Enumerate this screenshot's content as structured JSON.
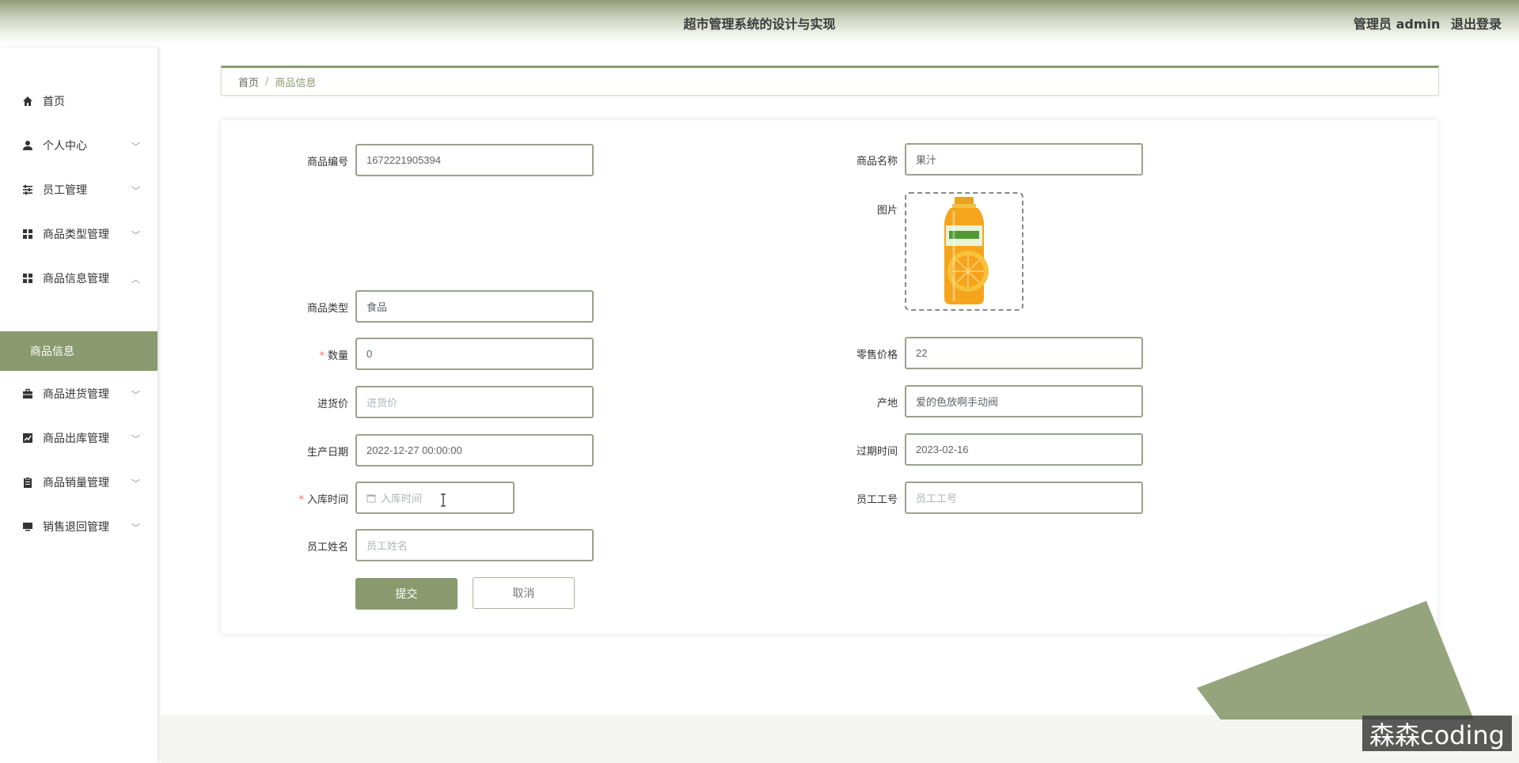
{
  "header": {
    "title": "超市管理系统的设计与实现",
    "user_label": "管理员 admin",
    "logout_label": "退出登录"
  },
  "sidebar": {
    "items": [
      {
        "label": "首页",
        "icon": "home-icon",
        "expandable": false
      },
      {
        "label": "个人中心",
        "icon": "person-icon",
        "expandable": true
      },
      {
        "label": "员工管理",
        "icon": "sliders-icon",
        "expandable": true
      },
      {
        "label": "商品类型管理",
        "icon": "grid-icon",
        "expandable": true
      },
      {
        "label": "商品信息管理",
        "icon": "grid-icon",
        "expandable": true,
        "expanded": true
      },
      {
        "label": "商品进货管理",
        "icon": "briefcase-icon",
        "expandable": true
      },
      {
        "label": "商品出库管理",
        "icon": "chart-icon",
        "expandable": true
      },
      {
        "label": "商品销量管理",
        "icon": "clipboard-icon",
        "expandable": true
      },
      {
        "label": "销售退回管理",
        "icon": "monitor-icon",
        "expandable": true
      }
    ],
    "active_sub": "商品信息"
  },
  "breadcrumb": {
    "home": "首页",
    "separator": "/",
    "current": "商品信息"
  },
  "form": {
    "product_no": {
      "label": "商品编号",
      "value": "1672221905394"
    },
    "product_name": {
      "label": "商品名称",
      "value": "果汁"
    },
    "image": {
      "label": "图片",
      "icon": "juice-bottle-image"
    },
    "product_type": {
      "label": "商品类型",
      "value": "食品"
    },
    "quantity": {
      "label": "数量",
      "value": "0",
      "required": "*"
    },
    "retail_price": {
      "label": "零售价格",
      "value": "22"
    },
    "purchase_price": {
      "label": "进货价",
      "placeholder": "进货价"
    },
    "origin": {
      "label": "产地",
      "value": "爱的色放啊手动阀"
    },
    "production_date": {
      "label": "生产日期",
      "value": "2022-12-27 00:00:00"
    },
    "expiry_time": {
      "label": "过期时间",
      "value": "2023-02-16"
    },
    "stock_in_time": {
      "label": "入库时间",
      "placeholder": "入库时间",
      "required": "*"
    },
    "employee_no": {
      "label": "员工工号",
      "placeholder": "员工工号"
    },
    "employee_name": {
      "label": "员工姓名",
      "placeholder": "员工姓名"
    },
    "submit_label": "提交",
    "cancel_label": "取消"
  },
  "watermark": "森森coding",
  "colors": {
    "accent": "#8a9a6e",
    "required": "#f56c6c",
    "border": "#9aa28a"
  }
}
